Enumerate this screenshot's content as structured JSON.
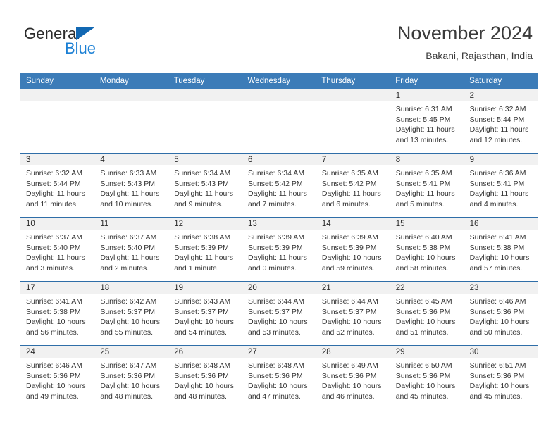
{
  "brand": {
    "name_top": "General",
    "name_bottom": "Blue",
    "color_dark": "#2b2b2b",
    "color_blue": "#1a7fd4",
    "triangle_color": "#1268b3"
  },
  "header": {
    "title": "November 2024",
    "subtitle": "Bakani, Rajasthan, India"
  },
  "theme": {
    "header_row_bg": "#3c7cb8",
    "header_row_text": "#ffffff",
    "daynum_band_bg": "#f1f1f1",
    "cell_bg": "#ffffff",
    "row_top_border": "#2f6ea8"
  },
  "weekday_headers": [
    "Sunday",
    "Monday",
    "Tuesday",
    "Wednesday",
    "Thursday",
    "Friday",
    "Saturday"
  ],
  "weeks": [
    [
      {
        "day": "",
        "empty": true
      },
      {
        "day": "",
        "empty": true
      },
      {
        "day": "",
        "empty": true
      },
      {
        "day": "",
        "empty": true
      },
      {
        "day": "",
        "empty": true
      },
      {
        "day": "1",
        "sunrise": "Sunrise: 6:31 AM",
        "sunset": "Sunset: 5:45 PM",
        "daylight": "Daylight: 11 hours and 13 minutes."
      },
      {
        "day": "2",
        "sunrise": "Sunrise: 6:32 AM",
        "sunset": "Sunset: 5:44 PM",
        "daylight": "Daylight: 11 hours and 12 minutes."
      }
    ],
    [
      {
        "day": "3",
        "sunrise": "Sunrise: 6:32 AM",
        "sunset": "Sunset: 5:44 PM",
        "daylight": "Daylight: 11 hours and 11 minutes."
      },
      {
        "day": "4",
        "sunrise": "Sunrise: 6:33 AM",
        "sunset": "Sunset: 5:43 PM",
        "daylight": "Daylight: 11 hours and 10 minutes."
      },
      {
        "day": "5",
        "sunrise": "Sunrise: 6:34 AM",
        "sunset": "Sunset: 5:43 PM",
        "daylight": "Daylight: 11 hours and 9 minutes."
      },
      {
        "day": "6",
        "sunrise": "Sunrise: 6:34 AM",
        "sunset": "Sunset: 5:42 PM",
        "daylight": "Daylight: 11 hours and 7 minutes."
      },
      {
        "day": "7",
        "sunrise": "Sunrise: 6:35 AM",
        "sunset": "Sunset: 5:42 PM",
        "daylight": "Daylight: 11 hours and 6 minutes."
      },
      {
        "day": "8",
        "sunrise": "Sunrise: 6:35 AM",
        "sunset": "Sunset: 5:41 PM",
        "daylight": "Daylight: 11 hours and 5 minutes."
      },
      {
        "day": "9",
        "sunrise": "Sunrise: 6:36 AM",
        "sunset": "Sunset: 5:41 PM",
        "daylight": "Daylight: 11 hours and 4 minutes."
      }
    ],
    [
      {
        "day": "10",
        "sunrise": "Sunrise: 6:37 AM",
        "sunset": "Sunset: 5:40 PM",
        "daylight": "Daylight: 11 hours and 3 minutes."
      },
      {
        "day": "11",
        "sunrise": "Sunrise: 6:37 AM",
        "sunset": "Sunset: 5:40 PM",
        "daylight": "Daylight: 11 hours and 2 minutes."
      },
      {
        "day": "12",
        "sunrise": "Sunrise: 6:38 AM",
        "sunset": "Sunset: 5:39 PM",
        "daylight": "Daylight: 11 hours and 1 minute."
      },
      {
        "day": "13",
        "sunrise": "Sunrise: 6:39 AM",
        "sunset": "Sunset: 5:39 PM",
        "daylight": "Daylight: 11 hours and 0 minutes."
      },
      {
        "day": "14",
        "sunrise": "Sunrise: 6:39 AM",
        "sunset": "Sunset: 5:39 PM",
        "daylight": "Daylight: 10 hours and 59 minutes."
      },
      {
        "day": "15",
        "sunrise": "Sunrise: 6:40 AM",
        "sunset": "Sunset: 5:38 PM",
        "daylight": "Daylight: 10 hours and 58 minutes."
      },
      {
        "day": "16",
        "sunrise": "Sunrise: 6:41 AM",
        "sunset": "Sunset: 5:38 PM",
        "daylight": "Daylight: 10 hours and 57 minutes."
      }
    ],
    [
      {
        "day": "17",
        "sunrise": "Sunrise: 6:41 AM",
        "sunset": "Sunset: 5:38 PM",
        "daylight": "Daylight: 10 hours and 56 minutes."
      },
      {
        "day": "18",
        "sunrise": "Sunrise: 6:42 AM",
        "sunset": "Sunset: 5:37 PM",
        "daylight": "Daylight: 10 hours and 55 minutes."
      },
      {
        "day": "19",
        "sunrise": "Sunrise: 6:43 AM",
        "sunset": "Sunset: 5:37 PM",
        "daylight": "Daylight: 10 hours and 54 minutes."
      },
      {
        "day": "20",
        "sunrise": "Sunrise: 6:44 AM",
        "sunset": "Sunset: 5:37 PM",
        "daylight": "Daylight: 10 hours and 53 minutes."
      },
      {
        "day": "21",
        "sunrise": "Sunrise: 6:44 AM",
        "sunset": "Sunset: 5:37 PM",
        "daylight": "Daylight: 10 hours and 52 minutes."
      },
      {
        "day": "22",
        "sunrise": "Sunrise: 6:45 AM",
        "sunset": "Sunset: 5:36 PM",
        "daylight": "Daylight: 10 hours and 51 minutes."
      },
      {
        "day": "23",
        "sunrise": "Sunrise: 6:46 AM",
        "sunset": "Sunset: 5:36 PM",
        "daylight": "Daylight: 10 hours and 50 minutes."
      }
    ],
    [
      {
        "day": "24",
        "sunrise": "Sunrise: 6:46 AM",
        "sunset": "Sunset: 5:36 PM",
        "daylight": "Daylight: 10 hours and 49 minutes."
      },
      {
        "day": "25",
        "sunrise": "Sunrise: 6:47 AM",
        "sunset": "Sunset: 5:36 PM",
        "daylight": "Daylight: 10 hours and 48 minutes."
      },
      {
        "day": "26",
        "sunrise": "Sunrise: 6:48 AM",
        "sunset": "Sunset: 5:36 PM",
        "daylight": "Daylight: 10 hours and 48 minutes."
      },
      {
        "day": "27",
        "sunrise": "Sunrise: 6:48 AM",
        "sunset": "Sunset: 5:36 PM",
        "daylight": "Daylight: 10 hours and 47 minutes."
      },
      {
        "day": "28",
        "sunrise": "Sunrise: 6:49 AM",
        "sunset": "Sunset: 5:36 PM",
        "daylight": "Daylight: 10 hours and 46 minutes."
      },
      {
        "day": "29",
        "sunrise": "Sunrise: 6:50 AM",
        "sunset": "Sunset: 5:36 PM",
        "daylight": "Daylight: 10 hours and 45 minutes."
      },
      {
        "day": "30",
        "sunrise": "Sunrise: 6:51 AM",
        "sunset": "Sunset: 5:36 PM",
        "daylight": "Daylight: 10 hours and 45 minutes."
      }
    ]
  ]
}
